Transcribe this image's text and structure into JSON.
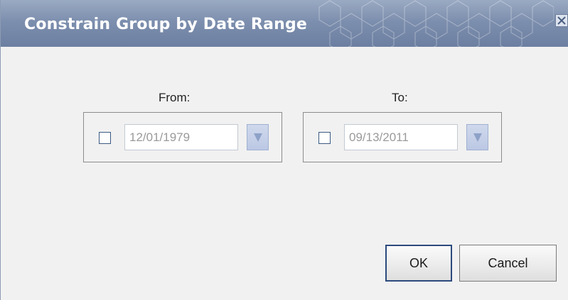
{
  "dialog": {
    "title": "Constrain Group by Date Range",
    "colors": {
      "titlebar": "#7d8fae",
      "title_text": "#ffffff",
      "body_bg": "#f1f1f1",
      "ok_border": "#2b4a7e"
    }
  },
  "from": {
    "label": "From:",
    "enabled": false,
    "date_value": "12/01/1979",
    "dropdown_icon": "triangle-down-icon"
  },
  "to": {
    "label": "To:",
    "enabled": false,
    "date_value": "09/13/2011",
    "dropdown_icon": "triangle-down-icon"
  },
  "buttons": {
    "ok_label": "OK",
    "cancel_label": "Cancel"
  },
  "close_icon": "close-icon"
}
